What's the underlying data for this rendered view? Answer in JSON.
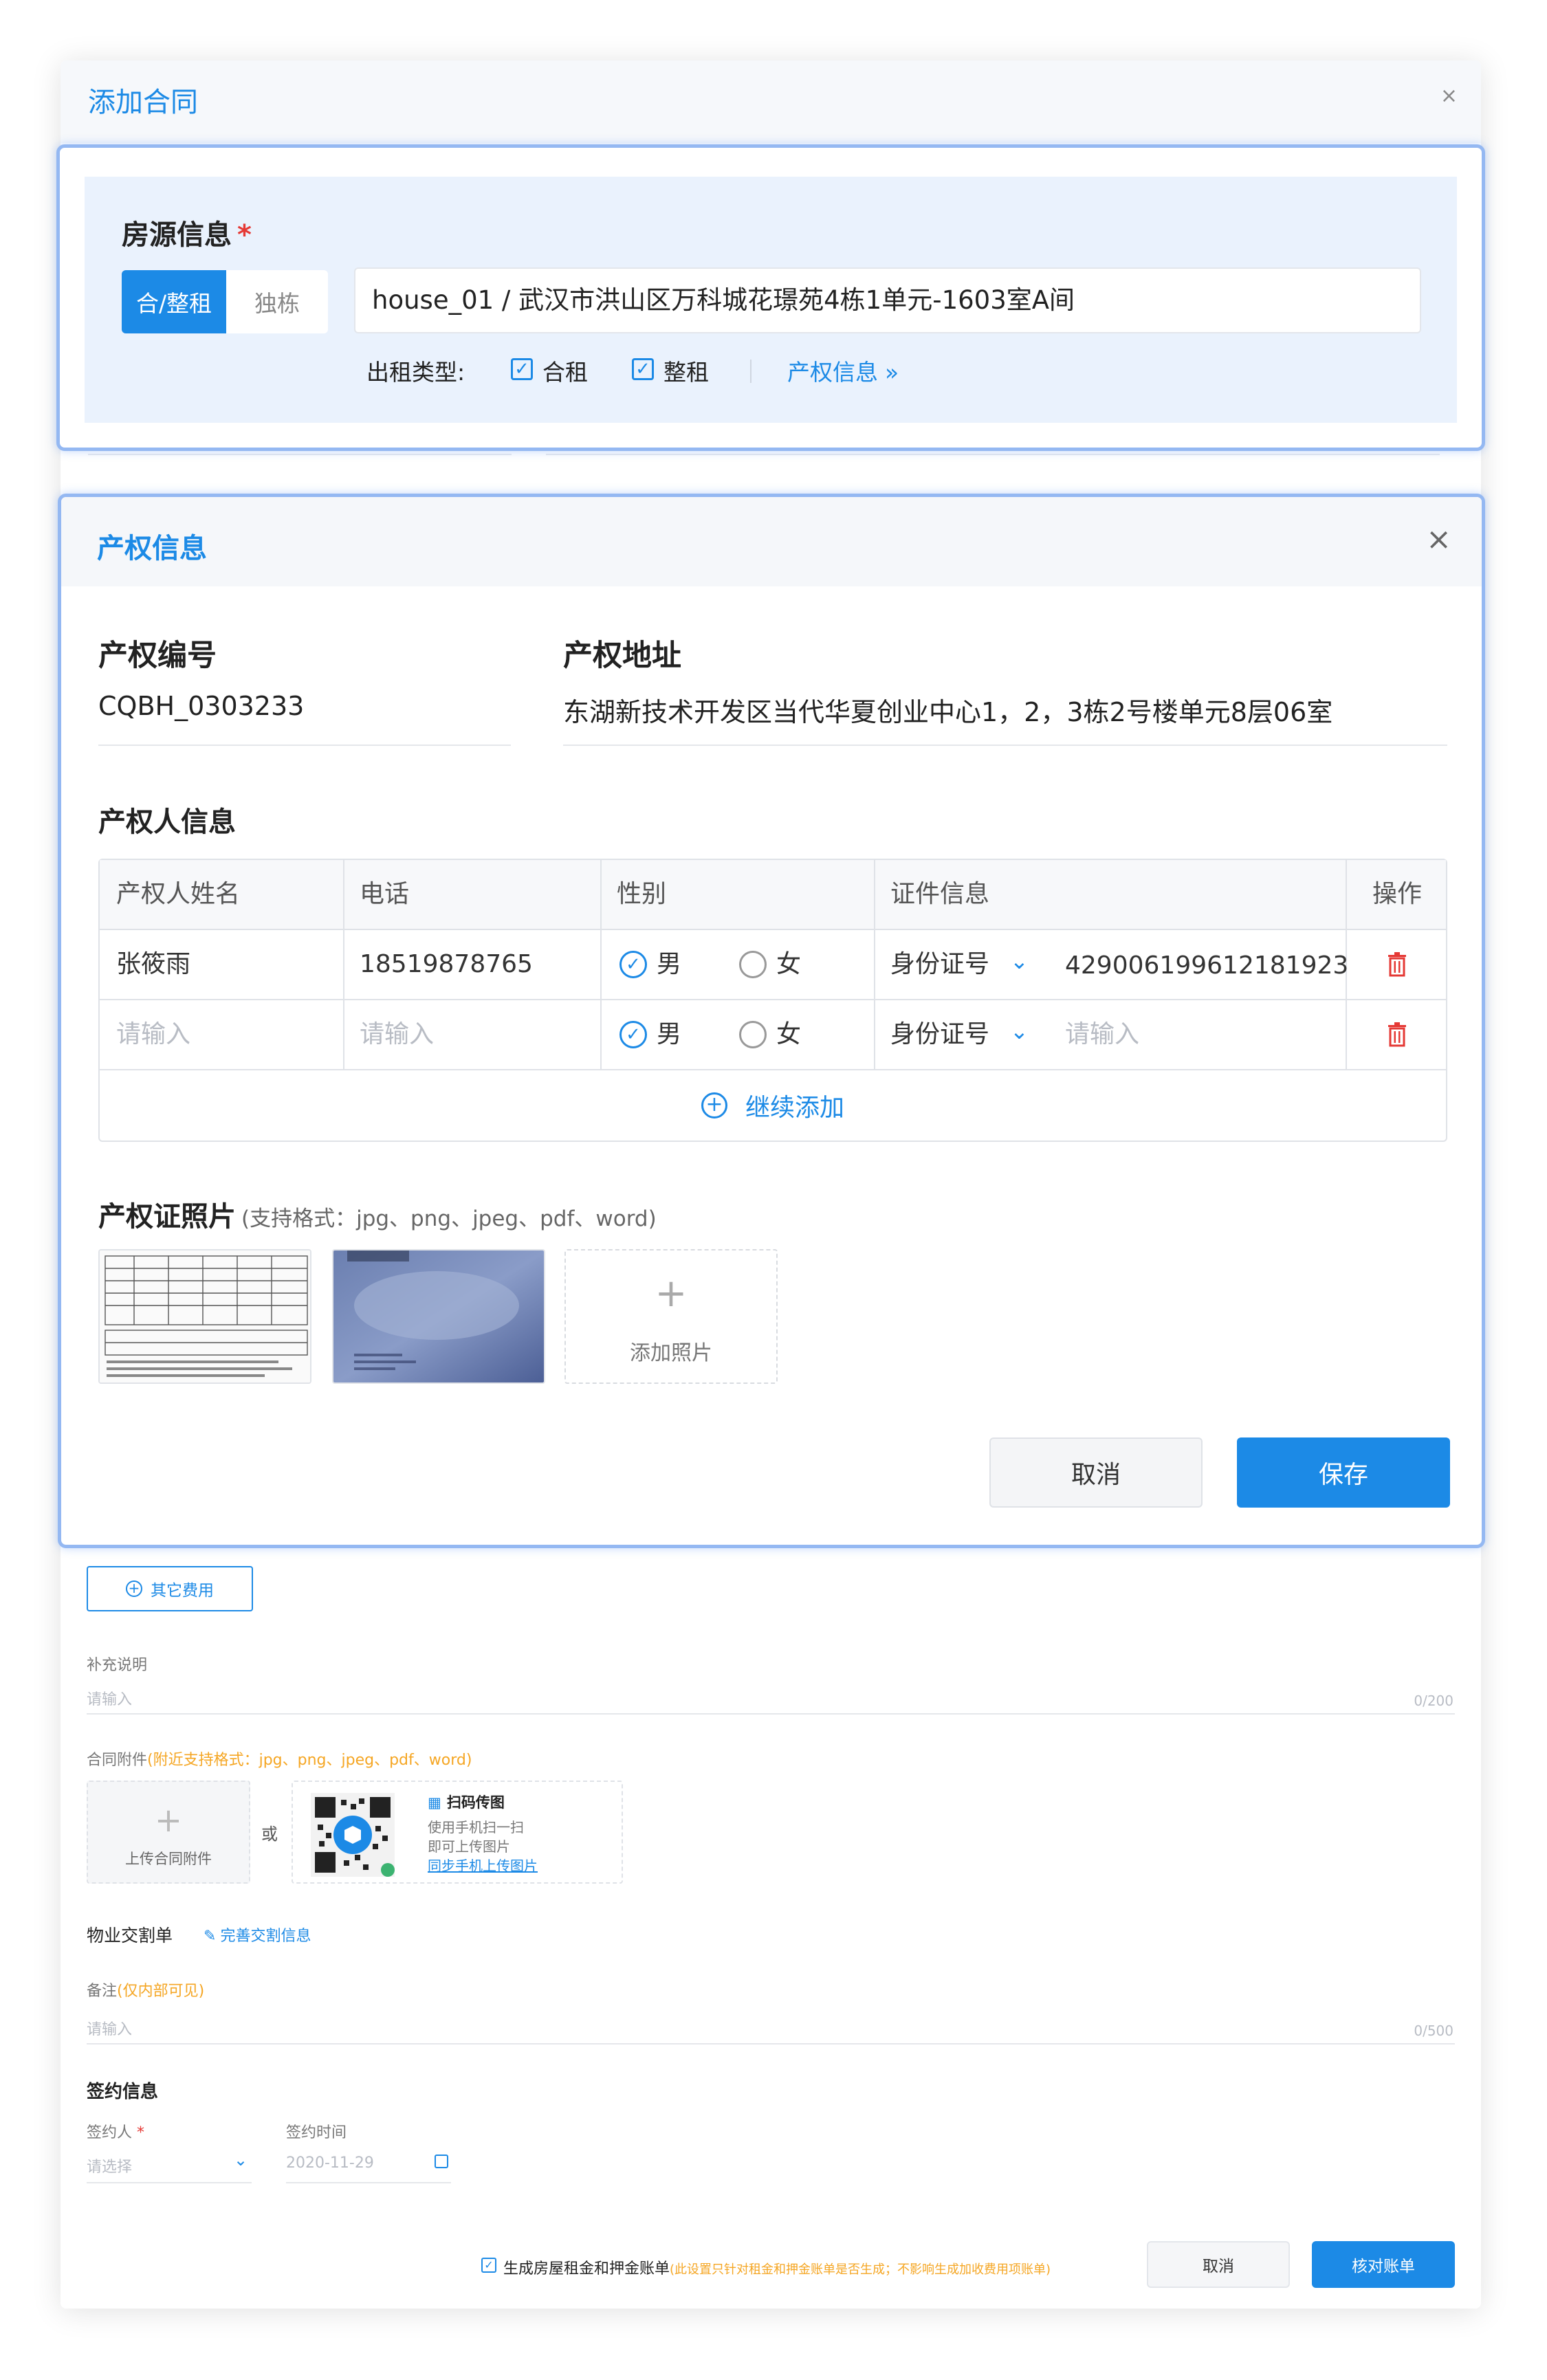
{
  "dialog": {
    "title": "添加合同",
    "close": "×"
  },
  "housing": {
    "section_title": "房源信息",
    "required_mark": "*",
    "segments": [
      "合/整租",
      "独栋"
    ],
    "address": "house_01 / 武汉市洪山区万科城花璟苑4栋1单元-1603室A间",
    "rent_type_label": "出租类型:",
    "rent_types": [
      "合租",
      "整租"
    ],
    "property_link": "产权信息"
  },
  "property": {
    "title": "产权信息",
    "close": "×",
    "number_label": "产权编号",
    "number_value": "CQBH_0303233",
    "address_label": "产权地址",
    "address_value": "东湖新技术开发区当代华夏创业中心1，2，3栋2号楼单元8层06室",
    "owner_section": "产权人信息",
    "table": {
      "headers": [
        "产权人姓名",
        "电话",
        "性别",
        "证件信息",
        "操作"
      ],
      "rows": [
        {
          "name": "张筱雨",
          "phone": "18519878765",
          "male": "男",
          "female": "女",
          "id_type": "身份证号",
          "id_number": "429006199612181923"
        },
        {
          "name": "请输入",
          "phone": "请输入",
          "male": "男",
          "female": "女",
          "id_type": "身份证号",
          "id_number": "请输入"
        }
      ],
      "add_more": "继续添加"
    },
    "photos_label": "产权证照片",
    "photos_hint": "(支持格式：jpg、png、jpeg、pdf、word)",
    "add_photo": "添加照片",
    "cancel": "取消",
    "save": "保存"
  },
  "other": {
    "other_fee": "其它费用",
    "remark_label": "补充说明",
    "remark_placeholder": "请输入",
    "remark_count": "0/200",
    "attach_label": "合同附件",
    "attach_hint": "(附近支持格式：jpg、png、jpeg、pdf、word)",
    "upload": "上传合同附件",
    "or": "或",
    "scan_title": "扫码传图",
    "scan_line1": "使用手机扫一扫",
    "scan_line2": "即可上传图片",
    "scan_link": "同步手机上传图片",
    "handover_label": "物业交割单",
    "handover_link": "完善交割信息",
    "note_label": "备注",
    "note_hint": "(仅内部可见)",
    "note_placeholder": "请输入",
    "note_count": "0/500",
    "sign_title": "签约信息",
    "signer_label": "签约人",
    "signer_placeholder": "请选择",
    "time_label": "签约时间",
    "time_value": "2020-11-29",
    "gen_bill": "生成房屋租金和押金账单",
    "gen_bill_hint": "(此设置只针对租金和押金账单是否生成；不影响生成加收费用项账单)",
    "cancel": "取消",
    "check": "核对账单"
  },
  "colors": {
    "accent": "#1c8ae6",
    "danger": "#e53935",
    "panel_border": "#94b8f2"
  }
}
